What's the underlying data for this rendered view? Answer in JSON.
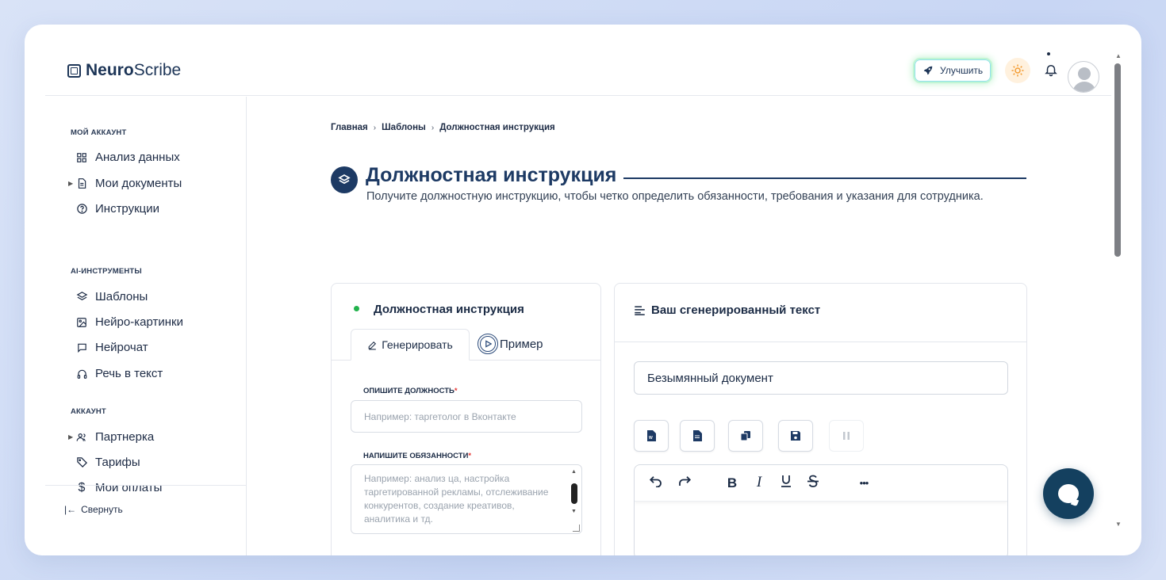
{
  "header": {
    "logo_bold": "Neuro",
    "logo_regular": "Scribe",
    "upgrade_label": "Улучшить"
  },
  "sidebar": {
    "sections": [
      {
        "title": "Мой аккаунт"
      },
      {
        "title": "AI-инструменты"
      },
      {
        "title": "Аккаунт"
      }
    ],
    "items": [
      {
        "label": "Анализ данных",
        "icon": "grid-icon"
      },
      {
        "label": "Мои документы",
        "icon": "document-icon"
      },
      {
        "label": "Инструкции",
        "icon": "help-circle-icon"
      },
      {
        "label": "Шаблоны",
        "icon": "layers-icon"
      },
      {
        "label": "Нейро-картинки",
        "icon": "image-icon"
      },
      {
        "label": "Нейрочат",
        "icon": "chat-icon"
      },
      {
        "label": "Речь в текст",
        "icon": "headphones-icon"
      },
      {
        "label": "Партнерка",
        "icon": "users-icon"
      },
      {
        "label": "Тарифы",
        "icon": "tag-icon"
      },
      {
        "label": "Мои оплаты",
        "icon": "dollar-icon"
      }
    ],
    "collapse_label": "Свернуть"
  },
  "breadcrumbs": [
    "Главная",
    "Шаблоны",
    "Должностная инструкция"
  ],
  "page": {
    "title": "Должностная инструкция",
    "subtitle": "Получите должностную инструкцию, чтобы четко определить обязанности, требования и указания для сотрудника."
  },
  "form_card": {
    "title": "Должностная инструкция",
    "tab_generate": "Генерировать",
    "tab_example": "Пример",
    "position_label": "Опишите должность",
    "position_placeholder": "Например: таргетолог в Вконтакте",
    "duties_label": "Напишите обязанности",
    "duties_placeholder": "Например: анализ ца, настройка таргетированной рекламы, отслеживание конкурентов, создание креативов, аналитика и тд.",
    "required_mark": "*"
  },
  "output_card": {
    "title": "Ваш сгенерированный текст",
    "doc_name": "Безымянный документ",
    "actions": [
      "word-export-icon",
      "file-export-icon",
      "copy-icon",
      "save-icon",
      "pause-icon"
    ],
    "toolbar": [
      "undo-icon",
      "redo-icon",
      "bold-icon",
      "italic-icon",
      "underline-icon",
      "strikethrough-icon",
      "more-icon"
    ],
    "bold_glyph": "B",
    "italic_glyph": "I",
    "more_glyph": "•••"
  },
  "colors": {
    "brand": "#1d3a64",
    "status": "#22b24c",
    "required": "#e53935",
    "chat": "#14405f"
  }
}
